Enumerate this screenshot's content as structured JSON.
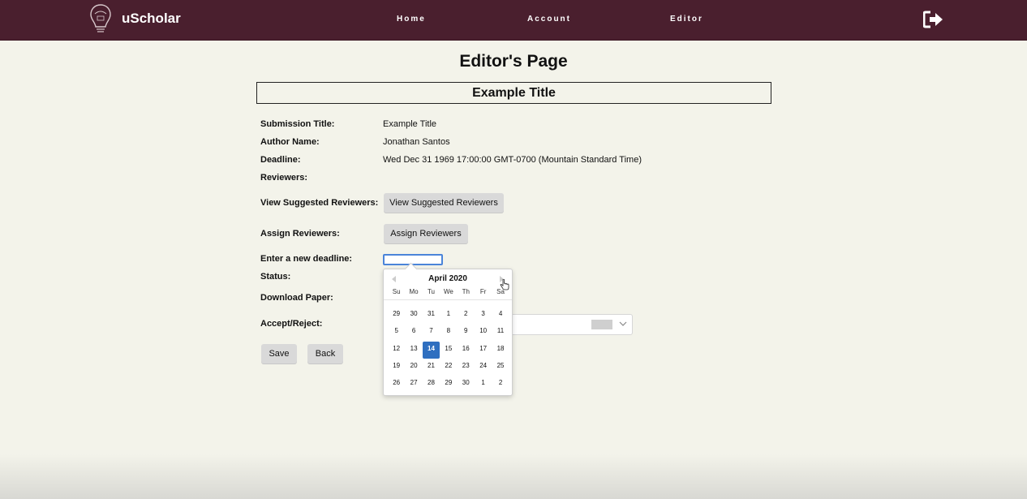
{
  "nav": {
    "brand": "uScholar",
    "links": [
      "Home",
      "Account",
      "Editor"
    ]
  },
  "page": {
    "heading": "Editor's Page",
    "title_box": "Example Title"
  },
  "form": {
    "submission_title_label": "Submission Title:",
    "submission_title_value": "Example Title",
    "author_label": "Author Name:",
    "author_value": "Jonathan Santos",
    "deadline_label": "Deadline:",
    "deadline_value": "Wed Dec 31 1969 17:00:00 GMT-0700 (Mountain Standard Time)",
    "reviewers_label": "Reviewers:",
    "view_suggested_label": "View Suggested Reviewers:",
    "view_suggested_button": "View Suggested Reviewers",
    "assign_label": "Assign Reviewers:",
    "assign_button": "Assign Reviewers",
    "new_deadline_label": "Enter a new deadline:",
    "new_deadline_value": "",
    "status_label": "Status:",
    "download_label": "Download Paper:",
    "accept_reject_label": "Accept/Reject:",
    "save_button": "Save",
    "back_button": "Back"
  },
  "calendar": {
    "month_label": "April 2020",
    "weekdays": [
      "Su",
      "Mo",
      "Tu",
      "We",
      "Th",
      "Fr",
      "Sa"
    ],
    "weeks": [
      [
        "29",
        "30",
        "31",
        "1",
        "2",
        "3",
        "4"
      ],
      [
        "5",
        "6",
        "7",
        "8",
        "9",
        "10",
        "11"
      ],
      [
        "12",
        "13",
        "14",
        "15",
        "16",
        "17",
        "18"
      ],
      [
        "19",
        "20",
        "21",
        "22",
        "23",
        "24",
        "25"
      ],
      [
        "26",
        "27",
        "28",
        "29",
        "30",
        "1",
        "2"
      ]
    ],
    "selected_day": "14"
  },
  "colors": {
    "navbar": "#4a1f2e",
    "background": "#f3f3ea",
    "selected_day": "#2f6fc0",
    "input_focus": "#4b84d9"
  }
}
